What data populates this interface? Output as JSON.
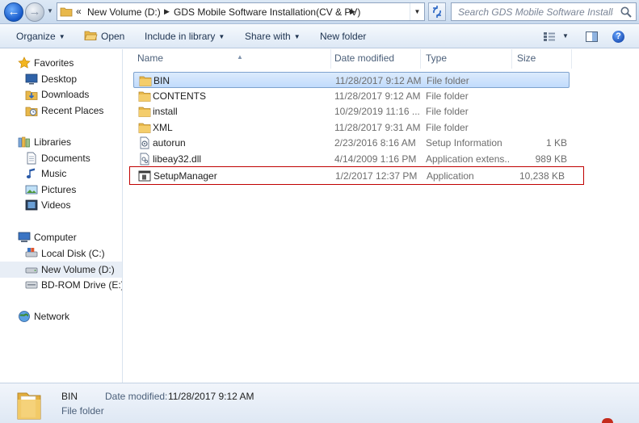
{
  "address_bar": {
    "overflow": "«",
    "crumbs": [
      "New Volume (D:)",
      "GDS Mobile Software Installation(CV & PV)"
    ],
    "search_placeholder": "Search GDS Mobile Software Installati..."
  },
  "toolbar": {
    "organize": "Organize",
    "open": "Open",
    "include_in_library": "Include in library",
    "share_with": "Share with",
    "new_folder": "New folder"
  },
  "nav": {
    "favorites": "Favorites",
    "desktop": "Desktop",
    "downloads": "Downloads",
    "recent_places": "Recent Places",
    "libraries": "Libraries",
    "documents": "Documents",
    "music": "Music",
    "pictures": "Pictures",
    "videos": "Videos",
    "computer": "Computer",
    "local_disk": "Local Disk (C:)",
    "new_volume": "New Volume (D:)",
    "bd_rom": "BD-ROM Drive (E:) C",
    "network": "Network"
  },
  "columns": {
    "name": "Name",
    "date_modified": "Date modified",
    "type": "Type",
    "size": "Size"
  },
  "files": [
    {
      "name": "BIN",
      "date": "11/28/2017 9:12 AM",
      "type": "File folder",
      "size": ""
    },
    {
      "name": "CONTENTS",
      "date": "11/28/2017 9:12 AM",
      "type": "File folder",
      "size": ""
    },
    {
      "name": "install",
      "date": "10/29/2019 11:16 ...",
      "type": "File folder",
      "size": ""
    },
    {
      "name": "XML",
      "date": "11/28/2017 9:31 AM",
      "type": "File folder",
      "size": ""
    },
    {
      "name": "autorun",
      "date": "2/23/2016 8:16 AM",
      "type": "Setup Information",
      "size": "1 KB"
    },
    {
      "name": "libeay32.dll",
      "date": "4/14/2009 1:16 PM",
      "type": "Application extens...",
      "size": "989 KB"
    },
    {
      "name": "SetupManager",
      "date": "1/2/2017 12:37 PM",
      "type": "Application",
      "size": "10,238 KB"
    }
  ],
  "details": {
    "name": "BIN",
    "type": "File folder",
    "date_label": "Date modified:",
    "date_value": "11/28/2017 9:12 AM"
  },
  "colors": {
    "selection": "#c1dbfc",
    "highlight_box": "#c00000",
    "folder": "#e8b84a"
  }
}
